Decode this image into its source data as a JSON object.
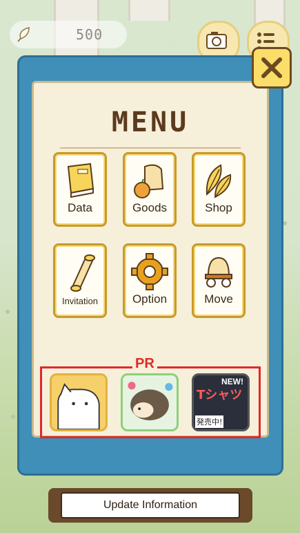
{
  "header": {
    "currency_amount": "500"
  },
  "menu": {
    "title": "MENU",
    "items": [
      {
        "label": "Data",
        "icon": "book-icon"
      },
      {
        "label": "Goods",
        "icon": "food-icon"
      },
      {
        "label": "Shop",
        "icon": "feathers-icon"
      },
      {
        "label": "Invitation",
        "icon": "scroll-icon"
      },
      {
        "label": "Option",
        "icon": "gear-icon"
      },
      {
        "label": "Move",
        "icon": "wagon-icon"
      }
    ]
  },
  "pr": {
    "label": "PR",
    "ads": [
      {
        "name": "cat-app-ad"
      },
      {
        "name": "hedgehog-app-ad"
      },
      {
        "name": "tshirt-ad",
        "badge": "NEW!",
        "headline": "Tシャツ",
        "subtext": "発売中!"
      }
    ]
  },
  "footer": {
    "update_label": "Update Information"
  },
  "colors": {
    "panel": "#3f8fb8",
    "tile_border": "#c79a2a",
    "pr_border": "#e0282a",
    "close_bg": "#fbdd6a"
  }
}
